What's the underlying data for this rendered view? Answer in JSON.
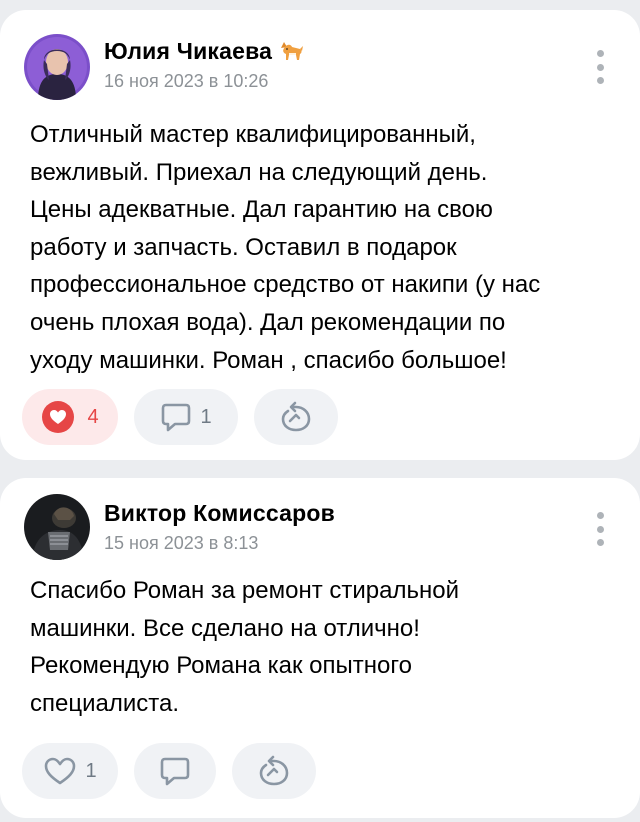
{
  "posts": [
    {
      "author": "Юлия Чикаева",
      "author_emoji": "dog-icon",
      "date": "16 ноя 2023 в 10:26",
      "text": "Отличный мастер квалифицированный,\nвежливый. Приехал на следующий день.\nЦены адекватные. Дал гарантию на свою\nработу и запчасть. Оставил в подарок\nпрофессиональное средство от накипи (у нас\nочень плохая вода). Дал рекомендации по\nуходу машинки. Роман , спасибо большое!",
      "likes": "4",
      "liked": true,
      "comments": "1",
      "share_icon": "share-icon"
    },
    {
      "author": "Виктор Комиссаров",
      "date": "15 ноя 2023 в 8:13",
      "text": "Спасибо Роман за ремонт стиральной\nмашинки. Все сделано на отлично!\nРекомендую Романа как опытного\nспециалиста.",
      "likes": "1",
      "liked": false,
      "comments": "",
      "share_icon": "share-icon"
    }
  ],
  "colors": {
    "background": "#ebedf0",
    "card": "#ffffff",
    "like_active": "#e64646",
    "like_active_bg": "#fde9ea",
    "action_bg": "#f0f2f5",
    "muted": "#8c9196"
  }
}
